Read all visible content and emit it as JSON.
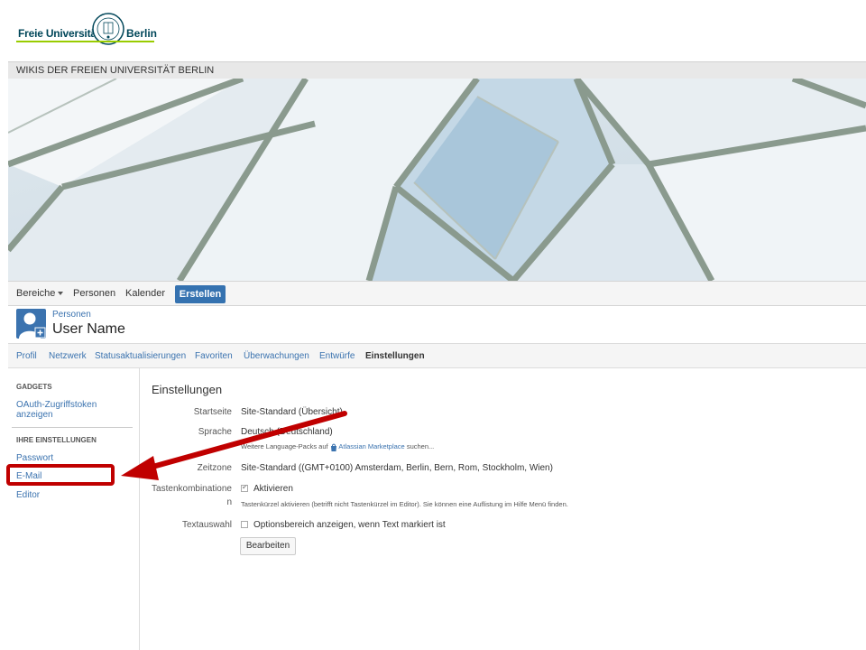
{
  "logo": {
    "left_text": "Freie Universität",
    "right_text": "Berlin"
  },
  "site": {
    "name": "WIKIS DER FREIEN UNIVERSITÄT BERLIN"
  },
  "nav": {
    "spaces": "Bereiche",
    "people": "Personen",
    "calendar": "Kalender",
    "create": "Erstellen"
  },
  "header": {
    "breadcrumb": "Personen",
    "title": "User Name"
  },
  "tabs": [
    {
      "label": "Profil"
    },
    {
      "label": "Netzwerk"
    },
    {
      "label": "Statusaktualisierungen"
    },
    {
      "label": "Favoriten"
    },
    {
      "label": "Überwachungen"
    },
    {
      "label": "Entwürfe"
    },
    {
      "label": "Einstellungen"
    }
  ],
  "sidebar": {
    "gadgets_heading": "GADGETS",
    "oauth_link_line1": "OAuth-Zugriffstoken",
    "oauth_link_line2": "anzeigen",
    "settings_heading": "IHRE EINSTELLUNGEN",
    "items": [
      {
        "label": "Passwort"
      },
      {
        "label": "E-Mail"
      },
      {
        "label": "Editor"
      }
    ]
  },
  "settings": {
    "title": "Einstellungen",
    "homepage_label": "Startseite",
    "homepage_value": "Site-Standard (Übersicht)",
    "language_label": "Sprache",
    "language_value": "Deutsch (Deutschland)",
    "language_hint_prefix": "Weitere Language-Packs auf",
    "language_hint_link": "Atlassian Marketplace",
    "language_hint_suffix": "suchen...",
    "timezone_label": "Zeitzone",
    "timezone_value": "Site-Standard ((GMT+0100) Amsterdam, Berlin, Bern, Rom, Stockholm, Wien)",
    "shortcuts_label_line1": "Tastenkombinatione",
    "shortcuts_label_line2": "n",
    "shortcuts_value": "Aktivieren",
    "shortcuts_hint": "Tastenkürzel aktivieren (betrifft nicht Tastenkürzel im Editor). Sie können eine Auflistung im Hilfe Menü finden.",
    "textselect_label": "Textauswahl",
    "textselect_value": "Optionsbereich anzeigen, wenn Text markiert ist",
    "edit_button": "Bearbeiten"
  },
  "colors": {
    "accent": "#3572b0",
    "link": "#3b73af",
    "highlight": "#c00000"
  }
}
